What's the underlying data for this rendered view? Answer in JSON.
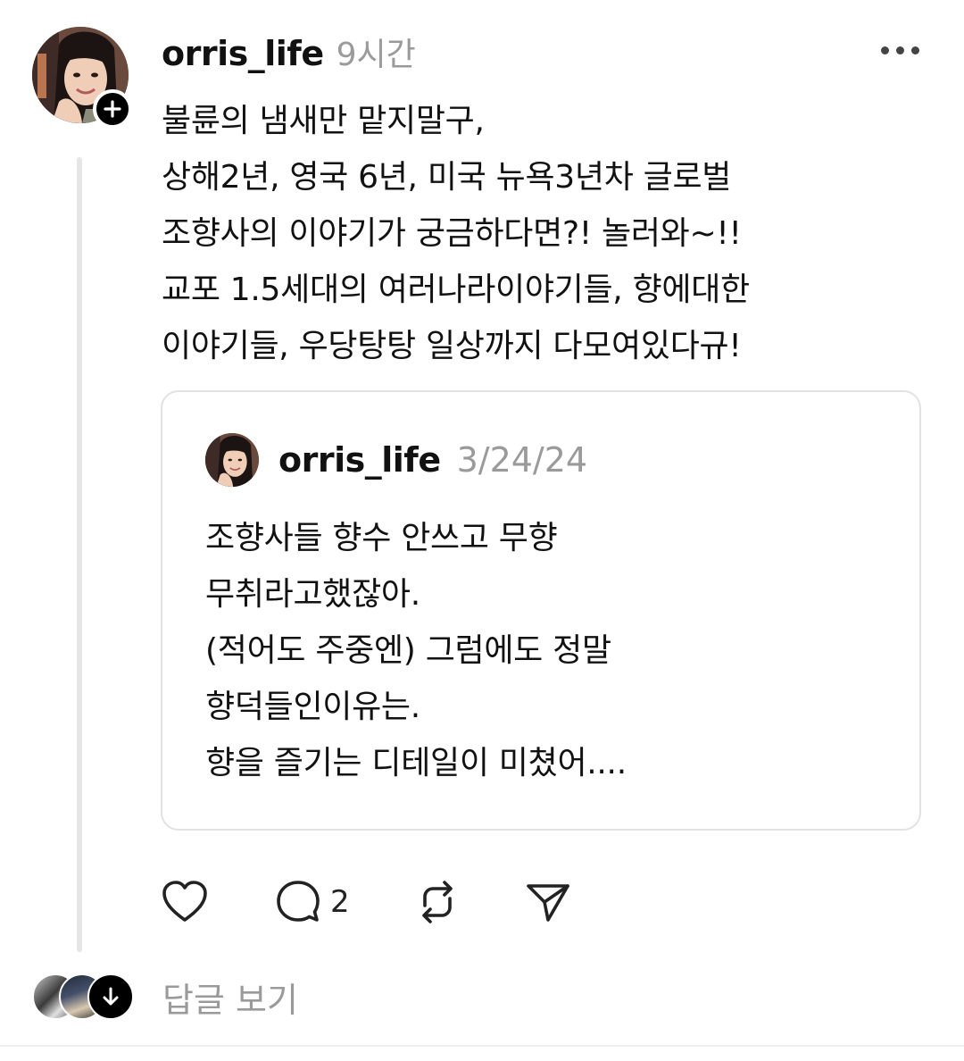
{
  "post": {
    "username": "orris_life",
    "time": "9시간",
    "avatar_icon": "profile-photo",
    "follow_icon": "plus-icon",
    "more_icon": "ellipsis-icon",
    "text_lines": [
      "불륜의 냄새만 맡지말구,",
      "상해2년, 영국 6년, 미국 뉴욕3년차 글로벌",
      "조향사의 이야기가 궁금하다면?! 놀러와~!!",
      "교포 1.5세대의 여러나라이야기들, 향에대한",
      "이야기들, 우당탕탕 일상까지 다모여있다규!"
    ]
  },
  "quote": {
    "username": "orris_life",
    "date": "3/24/24",
    "text_lines": [
      "조향사들 향수 안쓰고 무향",
      "무취라고했잖아.",
      "(적어도 주중엔) 그럼에도 정말",
      "향덕들인이유는.",
      "향을 즐기는 디테일이 미쳤어...."
    ]
  },
  "actions": {
    "like_icon": "heart-icon",
    "comment_icon": "comment-icon",
    "comment_count": "2",
    "repost_icon": "repost-icon",
    "share_icon": "send-icon"
  },
  "replies": {
    "label": "답글 보기",
    "expand_icon": "arrow-down-icon"
  },
  "colors": {
    "text": "#111111",
    "muted": "#9a9a9a",
    "border": "#e2e2e2",
    "thread_line": "#e6e6e6",
    "badge": "#000000"
  }
}
